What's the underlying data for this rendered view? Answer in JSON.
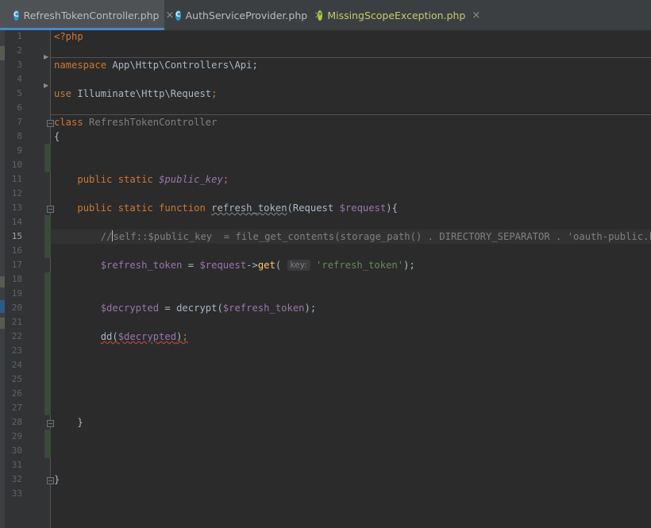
{
  "tabs": [
    {
      "label": "RefreshTokenController.php",
      "icon": "class-icon",
      "active": true,
      "closable": true
    },
    {
      "label": "AuthServiceProvider.php",
      "icon": "class-icon",
      "active": false,
      "closable": true
    },
    {
      "label": "MissingScopeException.php",
      "icon": "exception-icon",
      "active": false,
      "closable": true
    }
  ],
  "tab_close_glyph": "×",
  "gutter": {
    "line_numbers": [
      "1",
      "2",
      "3",
      "4",
      "5",
      "6",
      "7",
      "8",
      "9",
      "10",
      "11",
      "12",
      "13",
      "14",
      "15",
      "16",
      "17",
      "18",
      "19",
      "20",
      "21",
      "22",
      "23",
      "24",
      "25",
      "26",
      "27",
      "28",
      "29",
      "30",
      "31",
      "32",
      "33"
    ],
    "current_line": "15"
  },
  "code": {
    "l1": {
      "open_tag": "<?php"
    },
    "l3": {
      "kw": "namespace",
      "text": " App\\Http\\Controllers\\Api;"
    },
    "l5": {
      "kw": "use",
      "text": " Illuminate\\Http\\Request",
      "semi": ";"
    },
    "l7": {
      "kw": "class",
      "name": " RefreshTokenController"
    },
    "l8": {
      "text": "{"
    },
    "l11": {
      "indent": "    ",
      "kw": "public static",
      "var": "$public_key",
      "semi": ";"
    },
    "l13": {
      "indent": "    ",
      "kw": "public static function",
      "fname": "refresh_token",
      "p_open": "(Request ",
      "param": "$request",
      "p_close": "){"
    },
    "l15": {
      "indent": "        ",
      "slashes": "//",
      "comment": "self::$public_key  = file_get_contents(storage_path() . DIRECTORY_SEPARATOR . 'oauth-public.key');"
    },
    "l17": {
      "indent": "        ",
      "var": "$refresh_token",
      "eq": " = ",
      "obj": "$request",
      "arrow": "->",
      "method": "get",
      "paren": "( ",
      "hint": "key:",
      "str": "'refresh_token'",
      "end": ");"
    },
    "l20": {
      "indent": "        ",
      "var": "$decrypted",
      "mid": " = decrypt(",
      "arg": "$refresh_token",
      "end": ");"
    },
    "l22": {
      "indent": "        ",
      "fn": "dd(",
      "arg": "$decrypted",
      "close": ")",
      "semi": ";"
    },
    "l28": {
      "text": "    }"
    },
    "l32": {
      "text": "}"
    }
  },
  "colors": {
    "background": "#2b2b2b",
    "keyword": "#cc7832",
    "variable": "#9876aa",
    "string": "#6a8759",
    "function": "#ffc66d",
    "comment": "#808080",
    "active_tab_underline": "#4a88c7"
  }
}
